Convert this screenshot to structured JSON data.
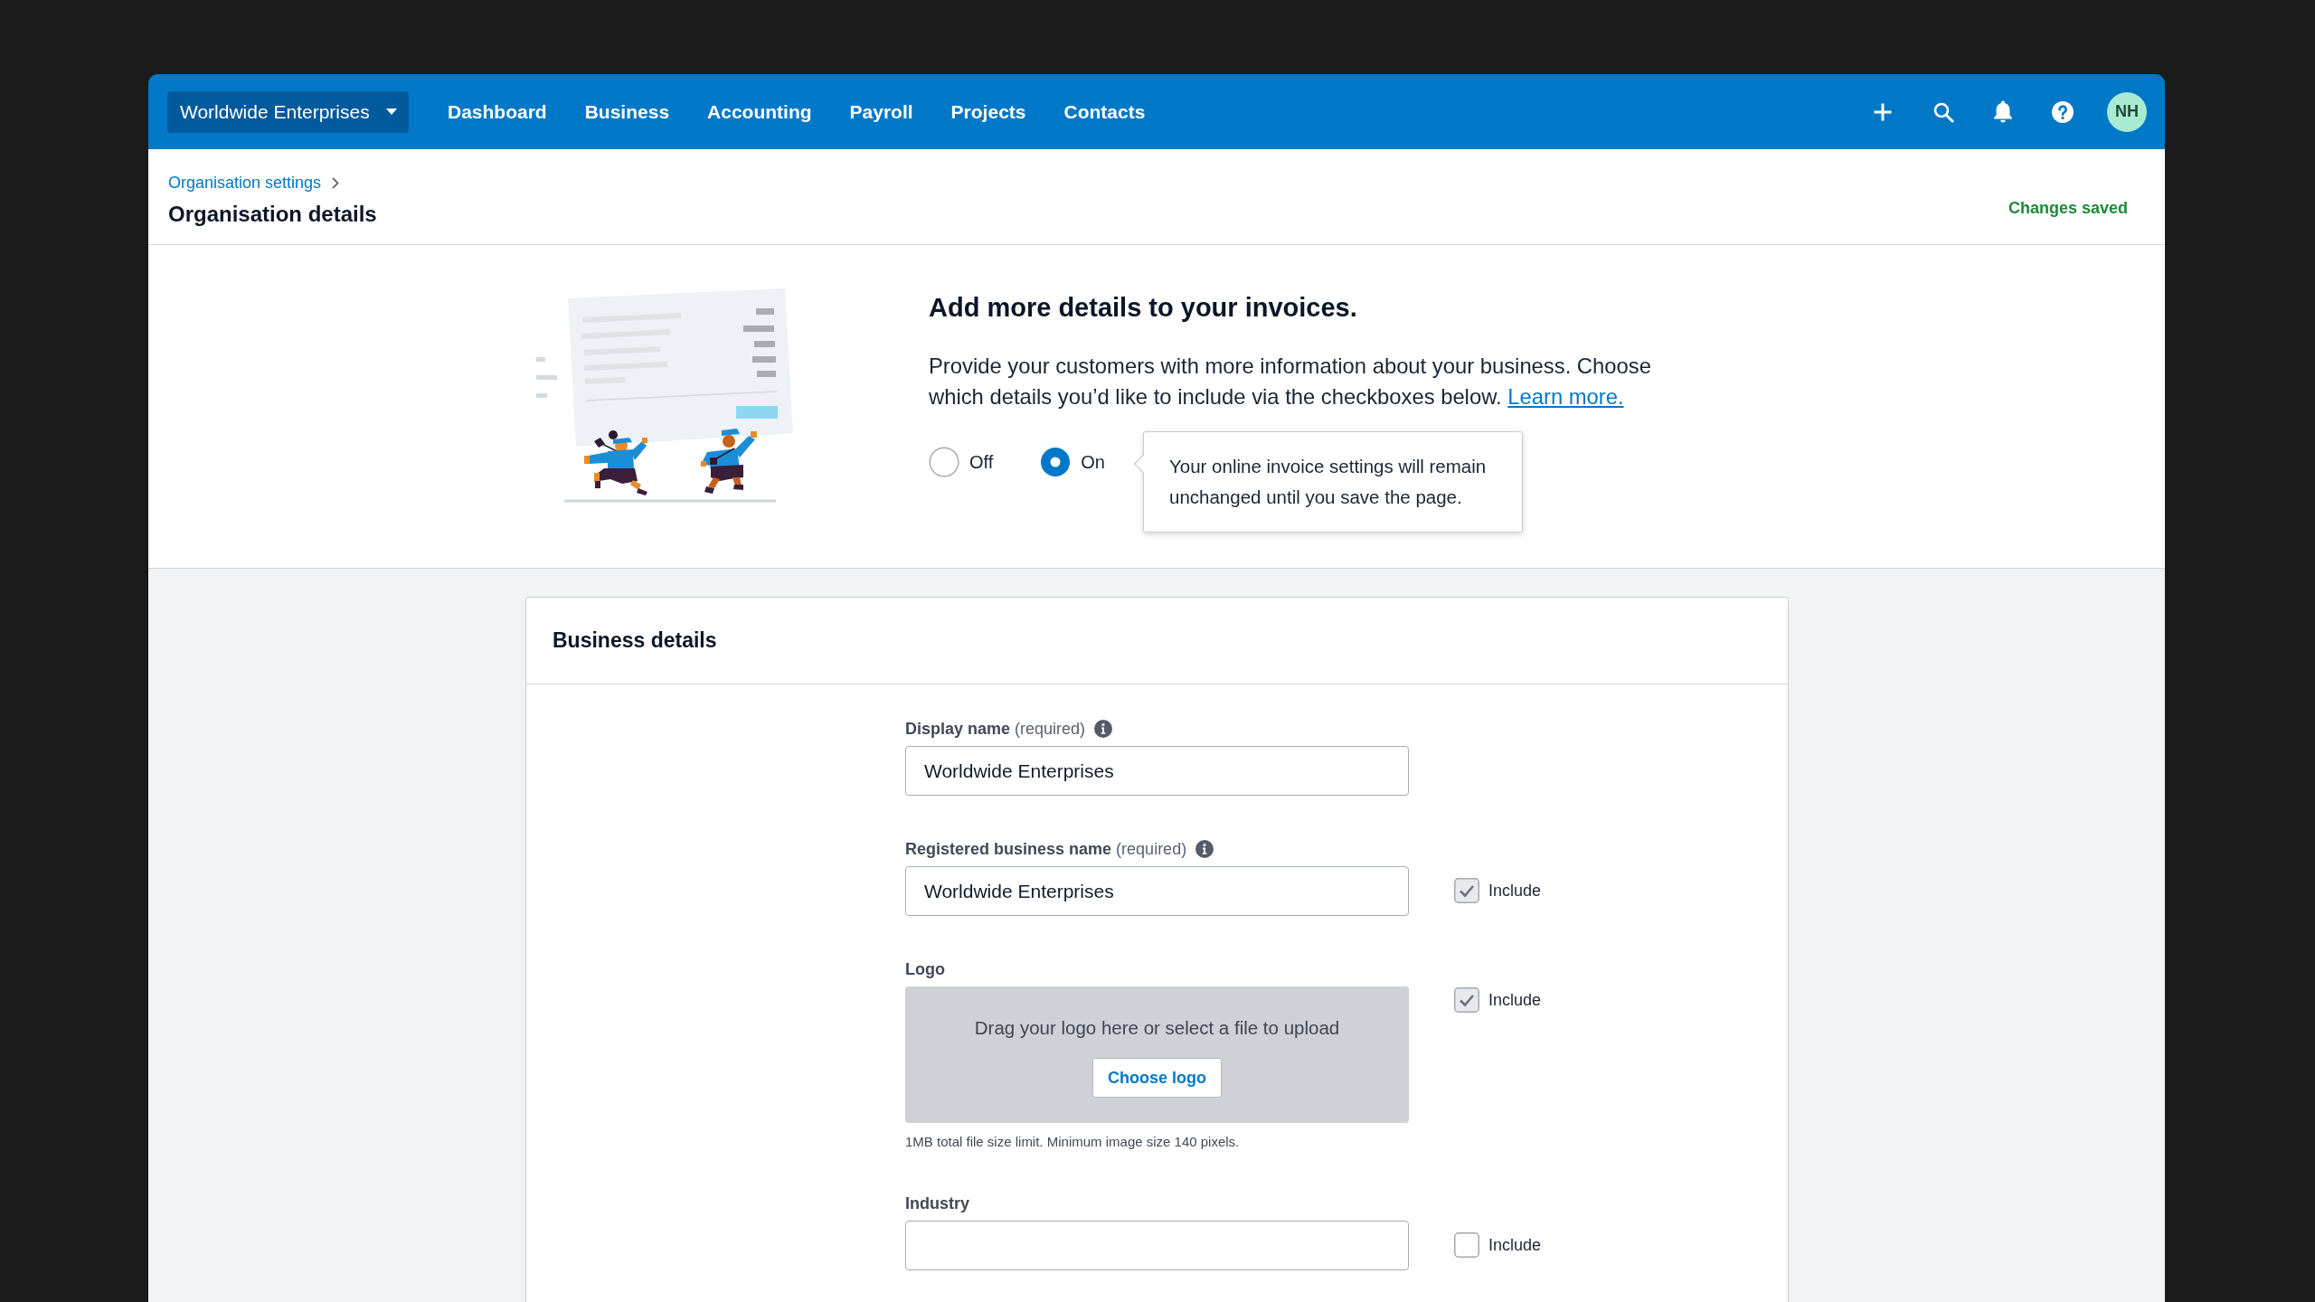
{
  "org_switcher": {
    "label": "Worldwide Enterprises"
  },
  "nav": {
    "items": [
      {
        "label": "Dashboard",
        "selected": false
      },
      {
        "label": "Business",
        "selected": false
      },
      {
        "label": "Accounting",
        "selected": false
      },
      {
        "label": "Payroll",
        "selected": false
      },
      {
        "label": "Projects",
        "selected": false
      },
      {
        "label": "Contacts",
        "selected": false
      }
    ]
  },
  "user_menu": {
    "initials": "NH"
  },
  "header": {
    "breadcrumb": "Organisation settings",
    "title": "Organisation details",
    "status": "Changes saved"
  },
  "invoice_banner": {
    "heading": "Add more details to your invoices.",
    "text": "Provide your customers with more information about your business. Choose which details you’d like to include via the checkboxes below.",
    "link": "Learn more.",
    "options": [
      {
        "label": "Off",
        "selected": false
      },
      {
        "label": "On",
        "selected": true
      }
    ],
    "tooltip": "Your online invoice settings will remain unchanged until you save the page."
  },
  "business_details": {
    "title": "Business details",
    "fields": [
      {
        "kind": "text",
        "label": "Display name",
        "note": "(required)",
        "info": true,
        "value": "Worldwide Enterprises"
      },
      {
        "kind": "text",
        "label": "Registered business name",
        "note": "(required)",
        "info": true,
        "value": "Worldwide Enterprises",
        "include": {
          "label": "Include",
          "checked": true
        }
      },
      {
        "kind": "upload",
        "label": "Logo",
        "info": false,
        "prompt": "Drag your logo here or select a file to upload",
        "button": "Choose logo",
        "hint": "1MB total file size limit. Minimum image size 140 pixels.",
        "include": {
          "label": "Include",
          "checked": true
        }
      },
      {
        "kind": "text",
        "label": "Industry",
        "info": false,
        "include": {
          "label": "Include",
          "checked": false
        }
      }
    ]
  }
}
